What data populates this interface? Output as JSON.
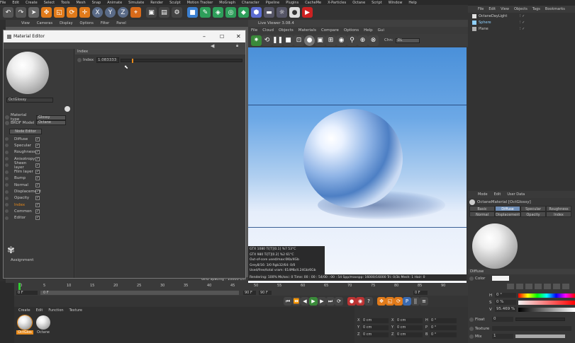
{
  "top_menu": [
    "File",
    "Edit",
    "Create",
    "Select",
    "Tools",
    "Mesh",
    "Snap",
    "Animate",
    "Simulate",
    "Render",
    "Sculpt",
    "Motion Tracker",
    "MoGraph",
    "Character",
    "Pipeline",
    "Plugins",
    "CacheMe",
    "X-Particles",
    "Octane",
    "Script",
    "Window",
    "Help"
  ],
  "top_toolbar": {
    "axis_x": "X",
    "axis_y": "Y",
    "axis_z": "Z"
  },
  "viewport": {
    "menu": [
      "View",
      "Cameras",
      "Display",
      "Options",
      "Filter",
      "Panel"
    ],
    "grid_spacing": "Grid Spacing : 10000 cm"
  },
  "material_editor": {
    "title": "Material Editor",
    "material_name": "OctGlossy",
    "material_type_label": "Material type",
    "material_type_value": "Glossy",
    "brdf_label": "BRDF Model",
    "brdf_value": "Octane",
    "node_editor_button": "Node Editor",
    "channels": [
      {
        "label": "Diffuse",
        "checked": true,
        "active": false
      },
      {
        "label": "Specular",
        "checked": true,
        "active": false
      },
      {
        "label": "Roughness",
        "checked": true,
        "active": false
      },
      {
        "label": "Anisotropy",
        "checked": true,
        "active": false
      },
      {
        "label": "Sheen layer",
        "checked": true,
        "active": false
      },
      {
        "label": "Film layer",
        "checked": true,
        "active": false
      },
      {
        "label": "Bump",
        "checked": true,
        "active": false
      },
      {
        "label": "Normal",
        "checked": true,
        "active": false
      },
      {
        "label": "Displacement",
        "checked": true,
        "active": false
      },
      {
        "label": "Opacity",
        "checked": true,
        "active": false
      },
      {
        "label": "Index",
        "checked": true,
        "active": true
      },
      {
        "label": "Common",
        "checked": true,
        "active": false
      },
      {
        "label": "Editor",
        "checked": true,
        "active": false
      }
    ],
    "assignment_label": "Assignment",
    "section_header": "Index",
    "index_label": "Index",
    "index_value": "1.083333",
    "index_fraction": 0.09
  },
  "live_viewer": {
    "title": "Live Viewer 3.08.4",
    "menu": [
      "File",
      "Cloud",
      "Objects",
      "Materials",
      "Compare",
      "Options",
      "Help",
      "Gui"
    ],
    "chn_label": "Chn:",
    "chn_value": "DL",
    "stats": [
      "GTX 1080 Ti[T][0.1]   %7    53°C",
      "GTX 980 Ti[T][0.2]    %2    61°C",
      "Out-of-core used/max:0Kb/4Gb",
      "Grey8/16: 3/0    Rgb32/64: 0/0",
      "Used/free/total vram: 614Mb/4.24Gb/6Gb"
    ],
    "status": "Rendering: 100%  Ms/sec: 0    Time: 00 : 00 : 54/00 : 00 : 54    Spp/maxspp: 16000/16000    Tri: 0/3k   Mesh: 1   Hair: 0"
  },
  "object_manager": {
    "menu": [
      "File",
      "Edit",
      "View",
      "Objects",
      "Tags",
      "Bookmarks"
    ],
    "objects": [
      "OctaneDayLight",
      "Sphere",
      "Plane"
    ]
  },
  "attribute_manager": {
    "menu": [
      "Mode",
      "Edit",
      "User Data"
    ],
    "material_title": "OctaneMaterial [OctGlossy]",
    "tabs_row1": [
      "Basic",
      "Diffuse",
      "Specular",
      "Roughness"
    ],
    "tabs_row2": [
      "Normal",
      "Displacement",
      "Opacity",
      "Index"
    ],
    "active_tab": "Diffuse",
    "section": "Diffuse",
    "color_label": "Color",
    "h_label": "H",
    "h_value": "0 °",
    "s_label": "S",
    "s_value": "0 %",
    "v_label": "V",
    "v_value": "95.469 %",
    "float_label": "Float",
    "float_value": "0",
    "texture_label": "Texture",
    "mix_label": "Mix",
    "mix_value": "1"
  },
  "timeline": {
    "ticks": [
      "0",
      "5",
      "10",
      "15",
      "20",
      "25",
      "30",
      "35",
      "40",
      "45",
      "50",
      "55",
      "60",
      "65",
      "70",
      "75",
      "80",
      "85",
      "90"
    ],
    "start_field": "0 F",
    "current_field": "0 F",
    "end_field": "90 F",
    "end_field2": "90 F",
    "frame_right": "0 F"
  },
  "material_manager": {
    "menu": [
      "Create",
      "Edit",
      "Function",
      "Texture"
    ],
    "materials": [
      {
        "name": "OctGlos",
        "selected": true
      },
      {
        "name": "Octane",
        "selected": false
      }
    ]
  },
  "coordinates": {
    "rows": [
      {
        "a": "X",
        "av": "0 cm",
        "b": "X",
        "bv": "0 cm",
        "c": "H",
        "cv": "0 °"
      },
      {
        "a": "Y",
        "av": "0 cm",
        "b": "Y",
        "bv": "0 cm",
        "c": "P",
        "cv": "0 °"
      },
      {
        "a": "Z",
        "av": "0 cm",
        "b": "Z",
        "bv": "0 cm",
        "c": "B",
        "cv": "0 °"
      }
    ]
  },
  "colors": {
    "accent_orange": "#e88a1a",
    "active_tab_blue": "#6f8fb8",
    "sky_blue": "#4a90d9"
  }
}
